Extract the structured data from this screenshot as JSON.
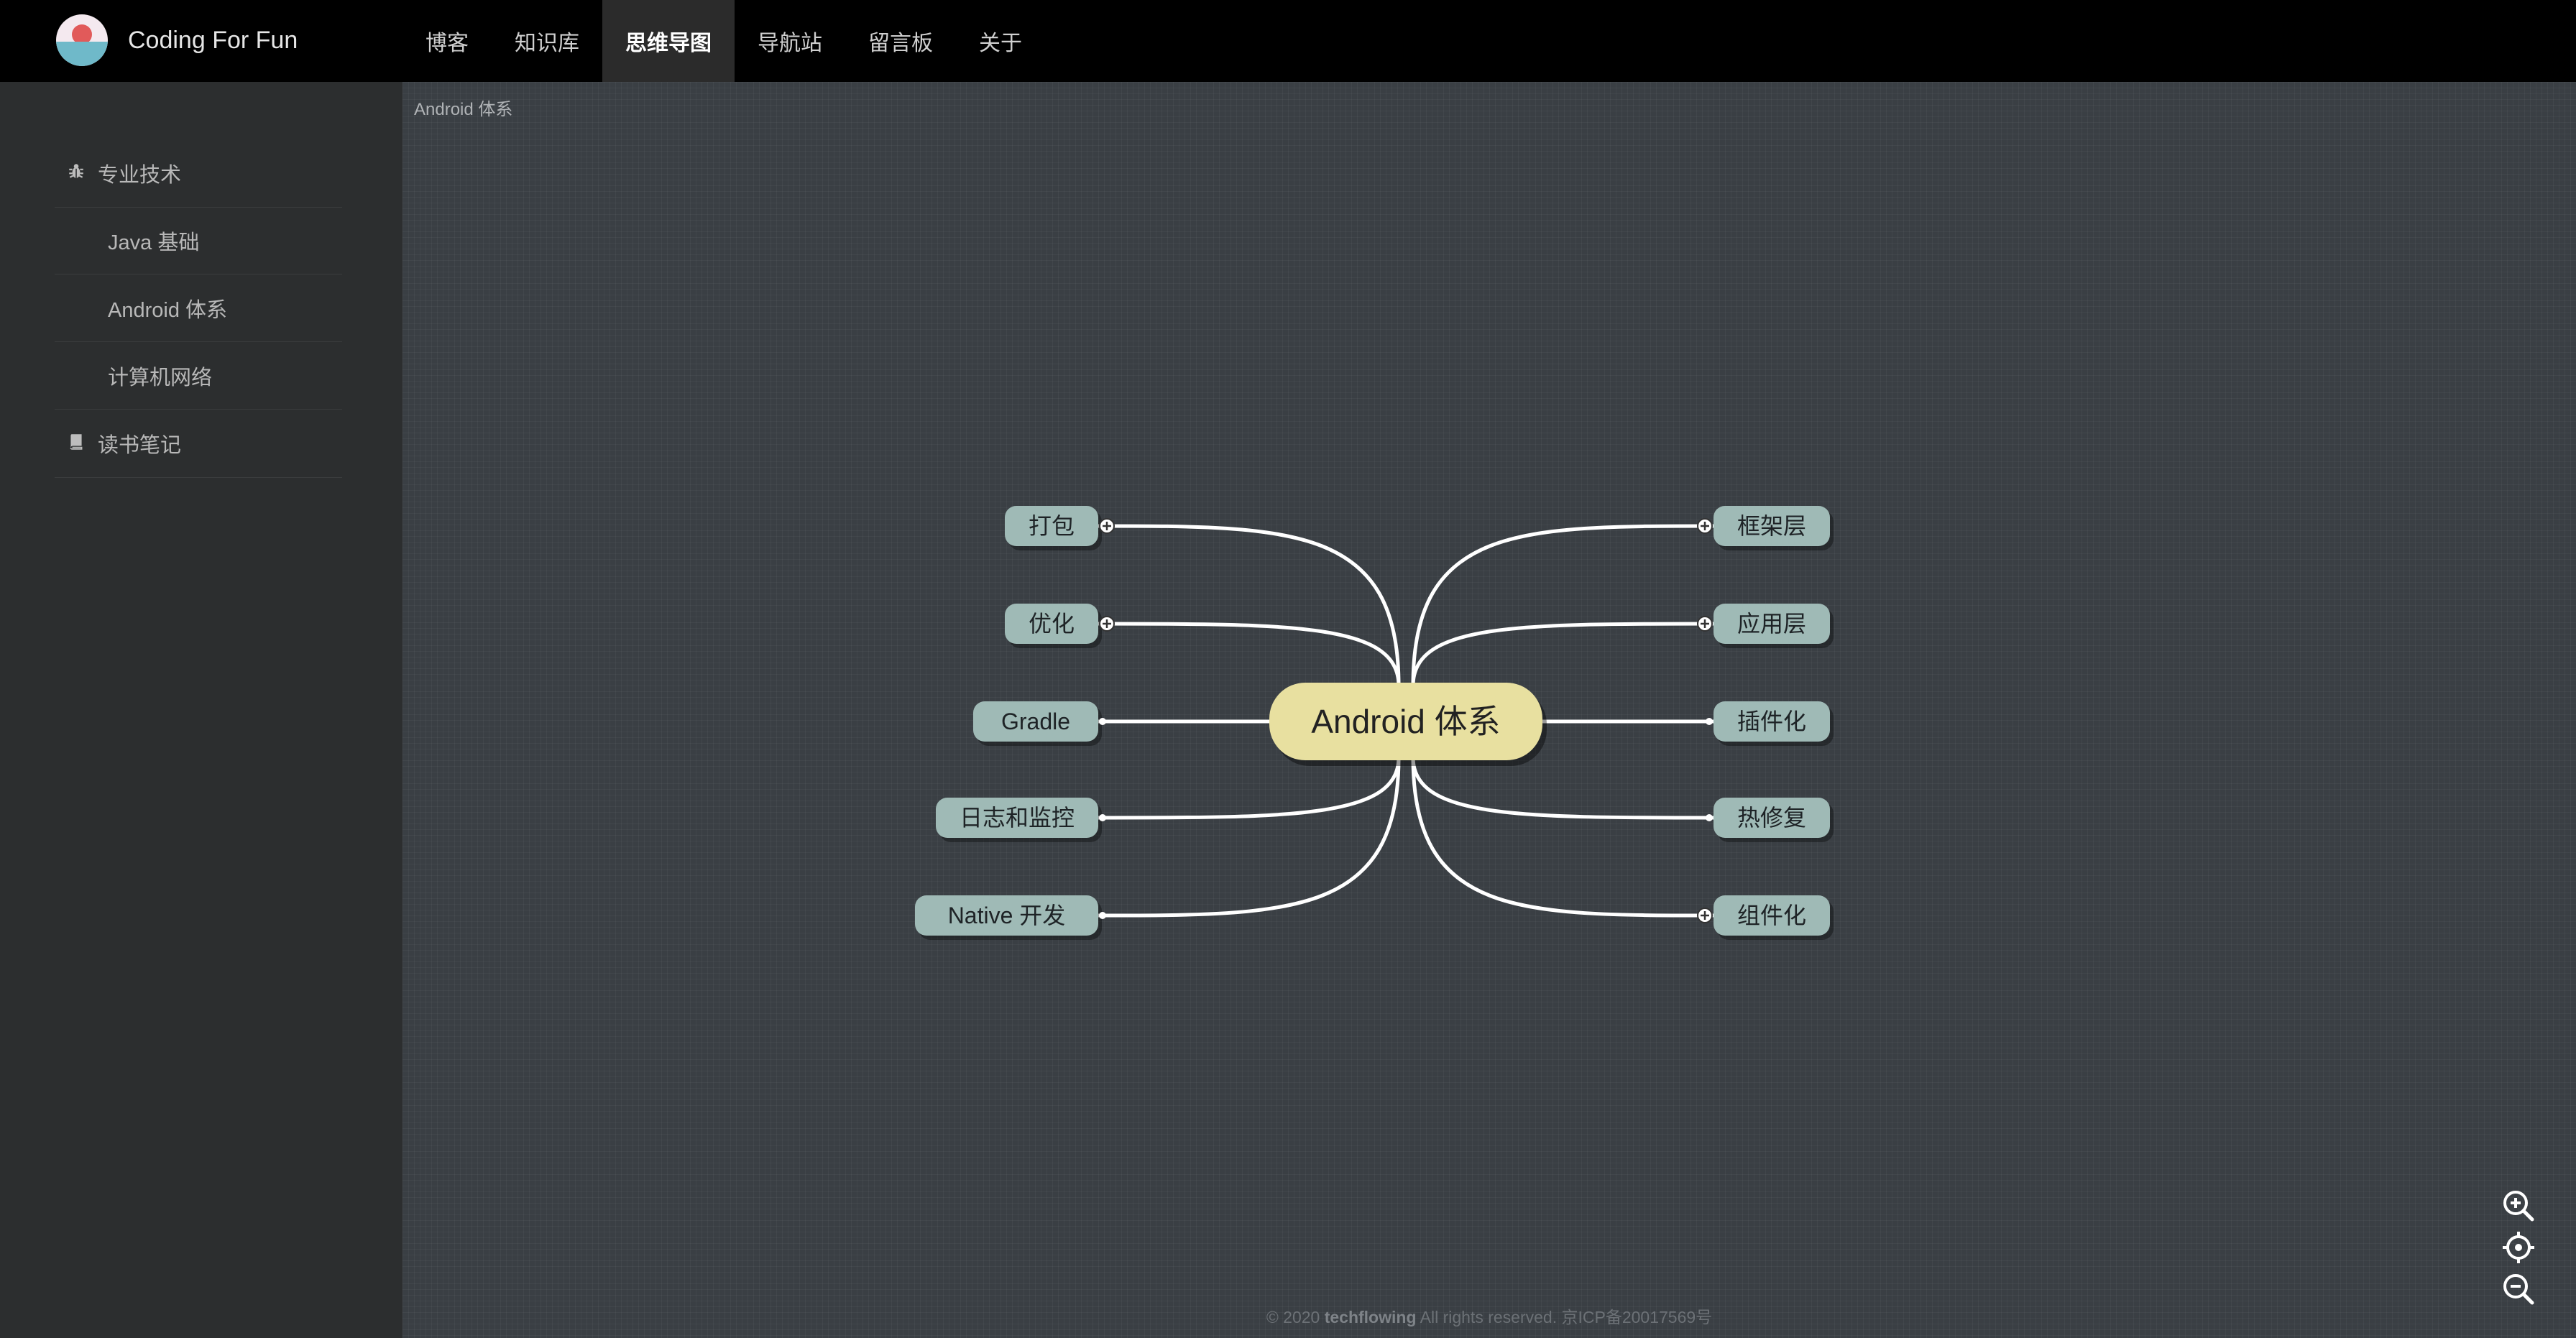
{
  "brand": {
    "name": "Coding For Fun"
  },
  "nav": {
    "items": [
      {
        "label": "博客"
      },
      {
        "label": "知识库"
      },
      {
        "label": "思维导图",
        "active": true
      },
      {
        "label": "导航站"
      },
      {
        "label": "留言板"
      },
      {
        "label": "关于"
      }
    ]
  },
  "sidebar": {
    "items": [
      {
        "label": "专业技术",
        "icon": "bug-icon"
      },
      {
        "label": "Java 基础"
      },
      {
        "label": "Android 体系"
      },
      {
        "label": "计算机网络"
      },
      {
        "label": "读书笔记",
        "icon": "book-icon"
      }
    ]
  },
  "breadcrumb": "Android 体系",
  "mindmap": {
    "root": "Android 体系",
    "left": [
      {
        "label": "打包",
        "expandable": true
      },
      {
        "label": "优化",
        "expandable": true
      },
      {
        "label": "Gradle",
        "expandable": false
      },
      {
        "label": "日志和监控",
        "expandable": false
      },
      {
        "label": "Native 开发",
        "expandable": false
      }
    ],
    "right": [
      {
        "label": "框架层",
        "expandable": true
      },
      {
        "label": "应用层",
        "expandable": true
      },
      {
        "label": "插件化",
        "expandable": false
      },
      {
        "label": "热修复",
        "expandable": false
      },
      {
        "label": "组件化",
        "expandable": true
      }
    ]
  },
  "tools": {
    "zoom_in": "zoom-in-icon",
    "recenter": "locate-icon",
    "zoom_out": "zoom-out-icon"
  },
  "footer": {
    "copyright": "© 2020",
    "owner": "techflowing",
    "rights": "All rights reserved.",
    "icp": "京ICP备20017569号"
  },
  "colors": {
    "root_node": "#e8e0a0",
    "child_node": "#9fbab6",
    "link": "#ffffff",
    "background": "#3a3f44"
  }
}
